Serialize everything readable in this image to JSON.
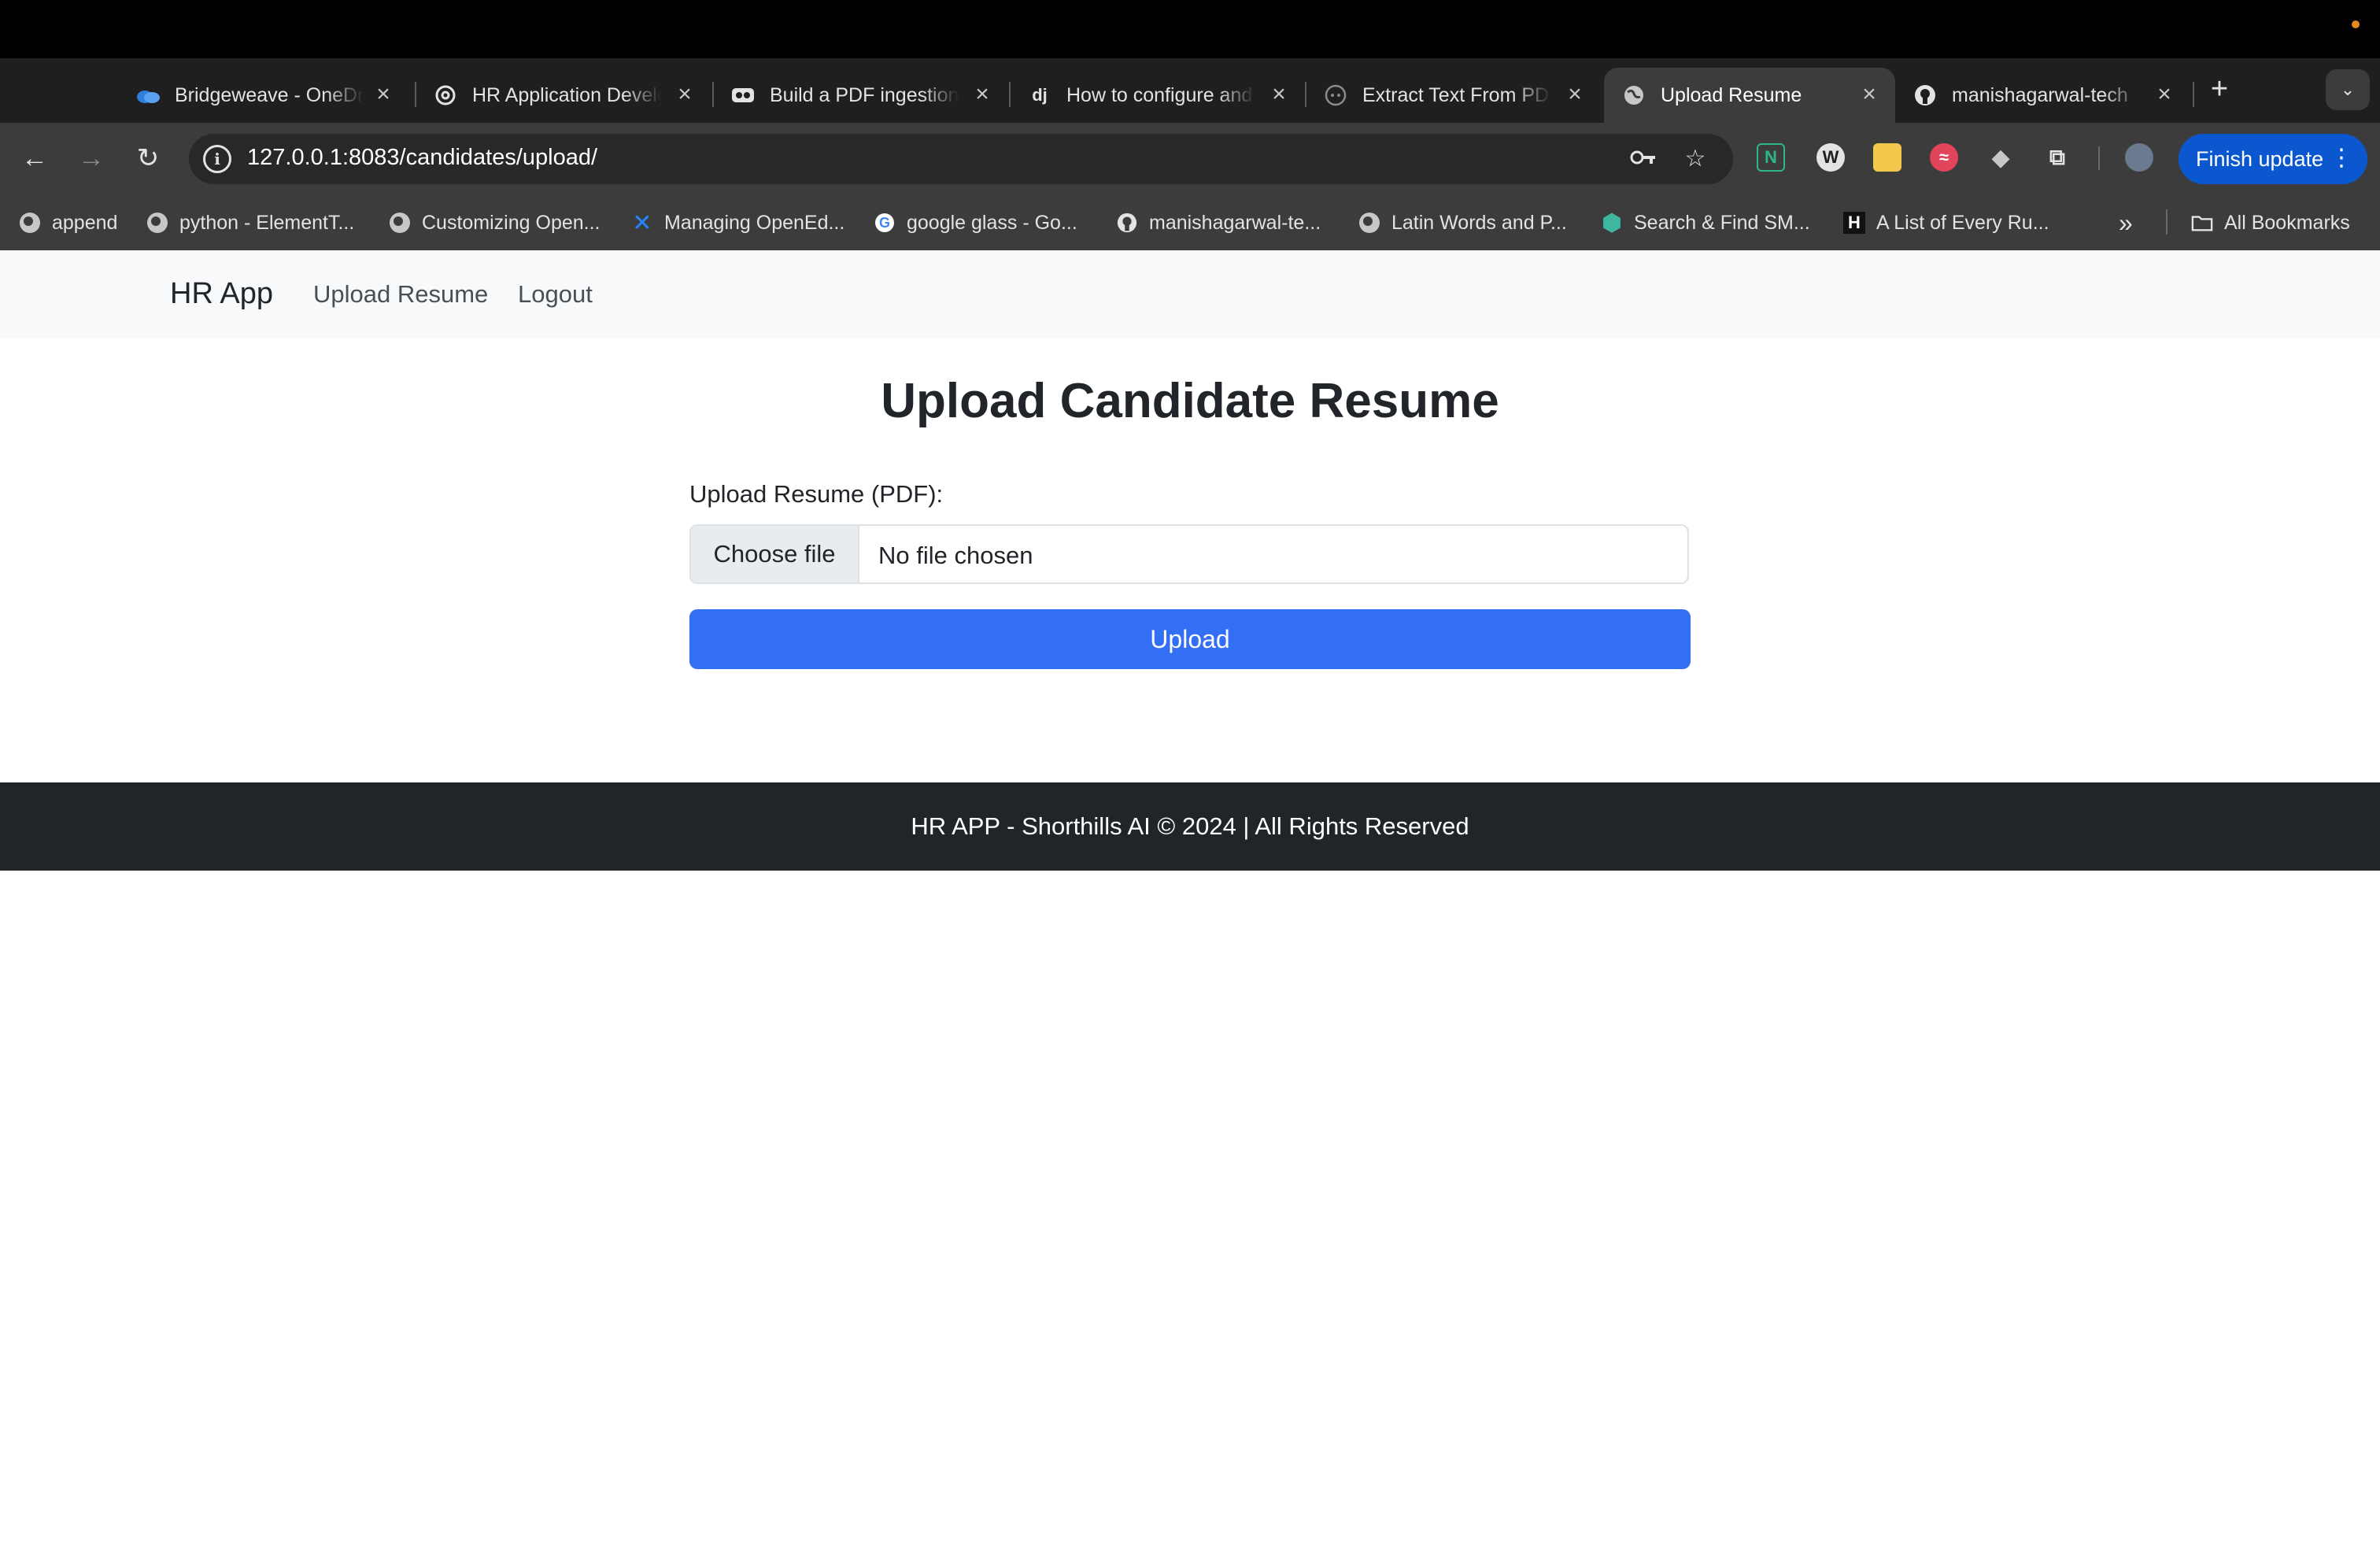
{
  "browser": {
    "tabs": [
      {
        "title": "Bridgeweave - OneDrive",
        "icon": "onedrive-cloud-icon",
        "active": false
      },
      {
        "title": "HR Application Development",
        "icon": "openai-icon",
        "active": false
      },
      {
        "title": "Build a PDF ingestion",
        "icon": "glasses-icon",
        "active": false
      },
      {
        "title": "How to configure and",
        "icon": "django-icon",
        "active": false
      },
      {
        "title": "Extract Text From PDF",
        "icon": "globe-icon",
        "active": false
      },
      {
        "title": "Upload Resume",
        "icon": "globe-icon",
        "active": true
      },
      {
        "title": "manishagarwal-tech",
        "icon": "github-icon",
        "active": false
      }
    ],
    "new_tab_glyph": "+",
    "tab_menu_glyph": "⌄",
    "url": "127.0.0.1:8083/candidates/upload/",
    "finish_update_label": "Finish update",
    "bookmarks": [
      {
        "label": "append",
        "icon": "globe-icon"
      },
      {
        "label": "python - ElementT...",
        "icon": "globe-icon"
      },
      {
        "label": "Customizing Open...",
        "icon": "globe-icon"
      },
      {
        "label": "Managing OpenEd...",
        "icon": "confluence-icon"
      },
      {
        "label": "google glass - Go...",
        "icon": "google-icon"
      },
      {
        "label": "manishagarwal-te...",
        "icon": "github-icon"
      },
      {
        "label": "Latin Words and P...",
        "icon": "globe-icon"
      },
      {
        "label": "Search & Find SM...",
        "icon": "hexagon-icon"
      },
      {
        "label": "A List of Every Ru...",
        "icon": "h-logo-icon"
      }
    ],
    "bookmarks_overflow_glyph": "»",
    "all_bookmarks_label": "All Bookmarks"
  },
  "page": {
    "brand": "HR App",
    "nav_links": [
      "Upload Resume",
      "Logout"
    ],
    "heading": "Upload Candidate Resume",
    "form_label": "Upload Resume (PDF):",
    "choose_file_label": "Choose file",
    "file_status": "No file chosen",
    "upload_button": "Upload",
    "footer": "HR APP - Shorthills AI © 2024 | All Rights Reserved"
  },
  "colors": {
    "primary_button": "#326ff4",
    "navbar_bg": "#f8f9fa",
    "footer_bg": "#212529",
    "chrome_update_button": "#0b57d0"
  }
}
